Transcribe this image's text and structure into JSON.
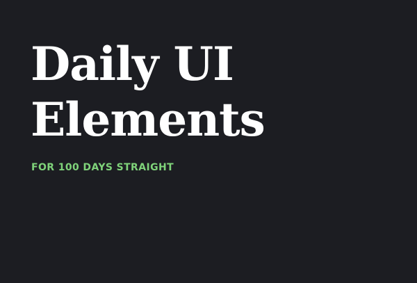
{
  "hero": {
    "title_line_1": "Daily UI",
    "title_line_2": "Elements",
    "subtitle": "FOR 100 DAYS STRAIGHT"
  },
  "colors": {
    "background": "#1c1d22",
    "title": "#ffffff",
    "accent": "#7fd37a"
  }
}
